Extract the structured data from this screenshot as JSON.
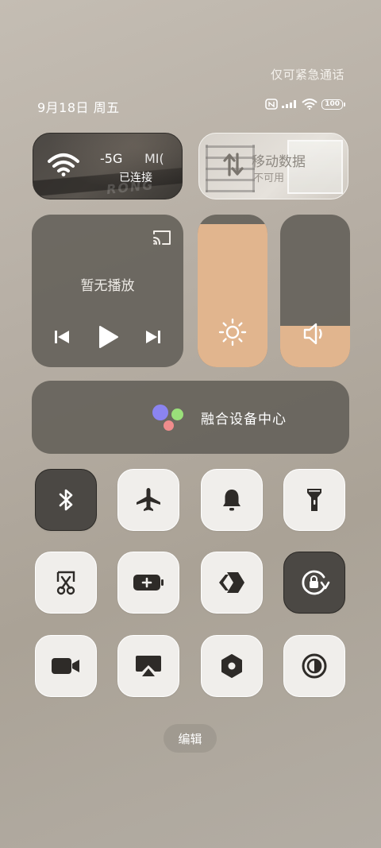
{
  "status_bar": {
    "emergency_text": "仅可紧急通话",
    "datetime": "9月18日 周五",
    "battery": "100"
  },
  "wifi_tile": {
    "ssid": "-5G",
    "ssid_ext": "MI(",
    "status": "已连接",
    "faded_text": "RONG"
  },
  "mobile_data_tile": {
    "title": "移动数据",
    "status": "不可用"
  },
  "media": {
    "title": "暂无播放"
  },
  "sliders": {
    "brightness_level": 0.94,
    "volume_level": 0.27
  },
  "fusion": {
    "label": "融合设备中心",
    "dot_colors": [
      "#8b84f0",
      "#9ae07a",
      "#f08c8c"
    ]
  },
  "toggles": [
    {
      "name": "bluetooth",
      "icon": "bluetooth-icon",
      "on": true
    },
    {
      "name": "airplane-mode",
      "icon": "airplane-icon",
      "on": false
    },
    {
      "name": "ring-mode",
      "icon": "bell-icon",
      "on": false
    },
    {
      "name": "flashlight",
      "icon": "flashlight-icon",
      "on": false
    },
    {
      "name": "screenshot",
      "icon": "screenshot-scissors-icon",
      "on": false
    },
    {
      "name": "battery-saver",
      "icon": "battery-plus-icon",
      "on": false
    },
    {
      "name": "nearby-share",
      "icon": "share-diamond-icon",
      "on": false
    },
    {
      "name": "rotation-lock",
      "icon": "rotation-lock-icon",
      "on": true
    },
    {
      "name": "screen-record",
      "icon": "video-camera-icon",
      "on": false
    },
    {
      "name": "screen-cast",
      "icon": "cast-screen-icon",
      "on": false
    },
    {
      "name": "settings-hex",
      "icon": "hexagon-nut-icon",
      "on": false
    },
    {
      "name": "dark-mode",
      "icon": "contrast-icon",
      "on": false
    }
  ],
  "edit_button": {
    "label": "编辑"
  },
  "colors": {
    "accent_fill": "#e1b58e",
    "tile_on": "#4b4844",
    "tile_off": "#f0eeeb"
  }
}
